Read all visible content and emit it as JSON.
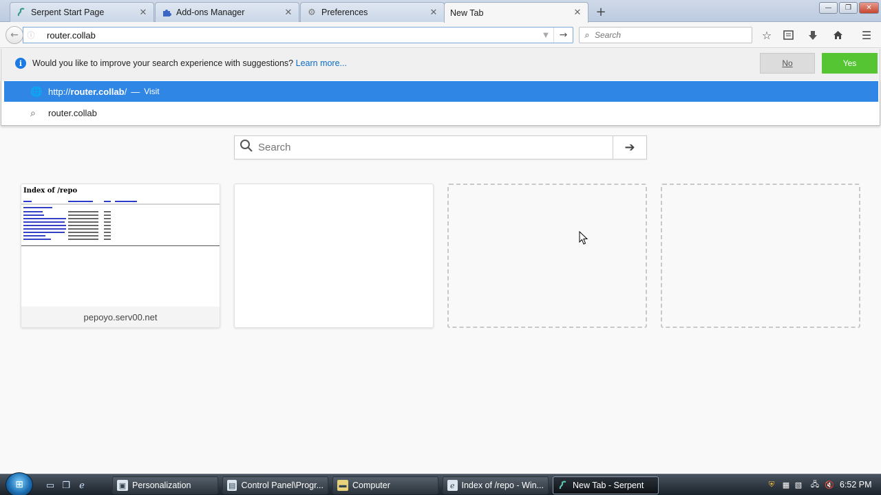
{
  "tabs": [
    {
      "title": "Serpent Start Page",
      "icon": "serpent-icon"
    },
    {
      "title": "Add-ons Manager",
      "icon": "puzzle-icon"
    },
    {
      "title": "Preferences",
      "icon": "gear-icon"
    },
    {
      "title": "New Tab",
      "icon": "none",
      "selected": true
    }
  ],
  "new_tab_button": "+",
  "window_controls": {
    "minimize": "—",
    "maximize": "❐",
    "close": "✕"
  },
  "navbar": {
    "url_value": "router.collab",
    "search_placeholder": "Search",
    "toolbar_icons": [
      "star-icon",
      "reading-list-icon",
      "download-icon",
      "home-icon",
      "menu-icon"
    ]
  },
  "notice": {
    "message": "Would you like to improve your search experience with suggestions?",
    "learn_more": "Learn more...",
    "no_label": "No",
    "yes_label": "Yes",
    "yes_color": "#56c534"
  },
  "autocomplete": {
    "items": [
      {
        "prefix": "http://",
        "host": "router.collab",
        "suffix": "/",
        "separator": "—",
        "action": "Visit",
        "icon": "globe-icon"
      },
      {
        "text": "router.collab",
        "icon": "search-icon"
      }
    ],
    "highlight_color": "#2f86e5"
  },
  "newtab": {
    "search_placeholder": "Search",
    "tiles": [
      {
        "caption": "pepoyo.serv00.net",
        "thumb_title": "Index of /repo"
      },
      {
        "caption": ""
      },
      {
        "caption": ""
      },
      {
        "caption": ""
      }
    ]
  },
  "taskbar": {
    "tasks": [
      {
        "label": "Personalization",
        "icon": "monitor-icon"
      },
      {
        "label": "Control Panel\\Progr...",
        "icon": "control-panel-icon"
      },
      {
        "label": "Computer",
        "icon": "folder-icon"
      },
      {
        "label": "Index of /repo - Win...",
        "icon": "ie-icon"
      },
      {
        "label": "New Tab - Serpent",
        "icon": "serpent-icon",
        "active": true
      }
    ],
    "clock": "6:52 PM"
  }
}
